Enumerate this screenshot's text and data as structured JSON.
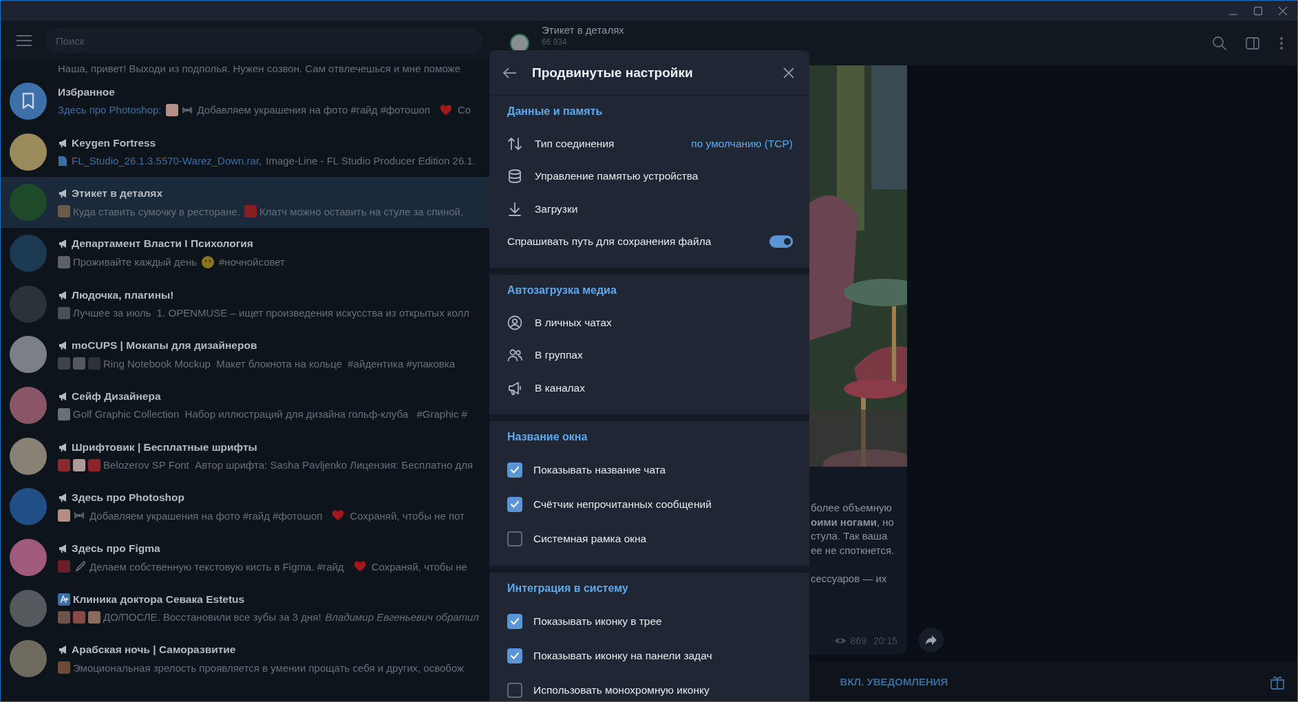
{
  "search": {
    "placeholder": "Поиск"
  },
  "chat_list_top": {
    "preview": "Наша, привет! Выходи из подполья. Нужен созвон. Сам отвлечешься и мне поможе"
  },
  "chats": [
    {
      "kind": "saved",
      "name": "Избранное",
      "color": "#3d6fa8",
      "selected": false,
      "preview": [
        {
          "kind": "link",
          "text": "Здесь про Photoshop:"
        },
        {
          "kind": "thumb",
          "color": "#b48f86"
        },
        {
          "kind": "bow"
        },
        {
          "kind": "text",
          "text": "Добавляем украшения на фото #гайд #фотошоп"
        },
        {
          "kind": "heart"
        },
        {
          "kind": "text",
          "text": "Со"
        }
      ]
    },
    {
      "kind": "channel",
      "name": "Keygen Fortress",
      "color": "#9a8a5c",
      "selected": false,
      "preview": [
        {
          "kind": "file"
        },
        {
          "kind": "link",
          "text": "FL_Studio_26.1.3.5570-Warez_Down.rar,"
        },
        {
          "kind": "text",
          "text": "Image-Line - FL Studio Producer Edition 26.1."
        }
      ]
    },
    {
      "kind": "channel",
      "name": "Этикет в деталях",
      "color": "#1f4a2a",
      "selected": true,
      "preview": [
        {
          "kind": "thumb",
          "color": "#6a5a48"
        },
        {
          "kind": "text",
          "text": "Куда ставить сумочку в ресторане."
        },
        {
          "kind": "thumb",
          "color": "#8a1e22"
        },
        {
          "kind": "text",
          "text": "Клатч можно оставить на стуле за спиной,"
        }
      ]
    },
    {
      "kind": "channel",
      "name": "Департамент Власти I Психология",
      "color": "#1c3a52",
      "selected": false,
      "preview": [
        {
          "kind": "thumb",
          "color": "#5e6268"
        },
        {
          "kind": "text",
          "text": "Проживайте каждый день"
        },
        {
          "kind": "emoji"
        },
        {
          "kind": "text",
          "text": "#ночнойсовет"
        }
      ]
    },
    {
      "kind": "channel",
      "name": "Людочка, плагины!",
      "color": "#2c323a",
      "selected": false,
      "preview": [
        {
          "kind": "thumb",
          "color": "#4a4f58"
        },
        {
          "kind": "text",
          "text": "Лучшее за июль  1. OPENMUSE – ищет произведения искусства из открытых колл"
        }
      ]
    },
    {
      "kind": "channel",
      "name": "moCUPS | Мокапы для дизайнеров",
      "color": "#7b7f86",
      "selected": false,
      "preview": [
        {
          "kind": "thumb",
          "color": "#3e4249"
        },
        {
          "kind": "thumb",
          "color": "#54585e"
        },
        {
          "kind": "thumb",
          "color": "#2e3237"
        },
        {
          "kind": "text",
          "text": "Ring Notebook Mockup  Макет блокнота на кольце  #айдентика #упаковка"
        }
      ]
    },
    {
      "kind": "channel",
      "name": "Сейф Дизайнера",
      "color": "#8a5566",
      "selected": false,
      "preview": [
        {
          "kind": "thumb",
          "color": "#6b6e72"
        },
        {
          "kind": "text",
          "text": "Golf Graphic Collection  Набор иллюстраций для дизайна гольф-клуба   #Graphic #"
        }
      ]
    },
    {
      "kind": "channel",
      "name": "Шрифтовик | Бесплатные шрифты",
      "color": "#8a8176",
      "selected": false,
      "preview": [
        {
          "kind": "thumb",
          "color": "#8a2a2e"
        },
        {
          "kind": "thumb",
          "color": "#b09a98"
        },
        {
          "kind": "thumb",
          "color": "#8f2428"
        },
        {
          "kind": "text",
          "text": "Belozerov SP Font  Автор шрифта: Sasha Pavljenko Лицензия: Бесплатно для"
        }
      ]
    },
    {
      "kind": "channel",
      "name": "Здесь про Photoshop",
      "color": "#1f4f86",
      "selected": false,
      "preview": [
        {
          "kind": "thumb",
          "color": "#b48f86"
        },
        {
          "kind": "bow"
        },
        {
          "kind": "text",
          "text": "Добавляем украшения на фото #гайд #фотошоп"
        },
        {
          "kind": "heart"
        },
        {
          "kind": "text",
          "text": "Сохраняй, чтобы не пот"
        }
      ]
    },
    {
      "kind": "channel",
      "name": "Здесь про Figma",
      "color": "#a05a7a",
      "selected": false,
      "preview": [
        {
          "kind": "thumb",
          "color": "#6a2026"
        },
        {
          "kind": "brush"
        },
        {
          "kind": "text",
          "text": "Делаем собственную текстовую кисть в Figma. #гайд"
        },
        {
          "kind": "heart"
        },
        {
          "kind": "text",
          "text": "Сохраняй, чтобы не"
        }
      ]
    },
    {
      "kind": "business",
      "name": "Клиника доктора Севака Estetus",
      "color": "#55585c",
      "selected": false,
      "preview": [
        {
          "kind": "thumb",
          "color": "#6e5448"
        },
        {
          "kind": "thumb",
          "color": "#8a4a44"
        },
        {
          "kind": "thumb",
          "color": "#8e6a5e"
        },
        {
          "kind": "text",
          "text": "ДО/ПОСЛЕ. Восстановили все зубы за 3 дня!"
        },
        {
          "kind": "italic",
          "text": "Владимир Евгеньевич обратил"
        }
      ]
    },
    {
      "kind": "channel",
      "name": "Арабская ночь | Саморазвитие",
      "color": "#6f6a5e",
      "selected": false,
      "preview": [
        {
          "kind": "thumb",
          "color": "#6e4a38"
        },
        {
          "kind": "text",
          "text": "Эмоциональная зрелость проявляется в умении прощать себя и других, освобож"
        }
      ]
    }
  ],
  "chat": {
    "title": "Этикет в деталях",
    "subtitle": "66 934",
    "message": {
      "paragraphs": [
        [
          "более объемную",
          "**оими ногами**, но",
          "стула. Так ваша",
          "ее не споткнется."
        ],
        [
          "сессуаров — их"
        ]
      ],
      "views": "869",
      "time": "20:15"
    },
    "bottom_button": "ВКЛ. УВЕДОМЛЕНИЯ"
  },
  "settings": {
    "title": "Продвинутые настройки",
    "sections": [
      {
        "title": "Данные и память",
        "rows": [
          {
            "kind": "connection",
            "label": "Тип соединения",
            "value": "по умолчанию (TCP)"
          },
          {
            "kind": "storage",
            "label": "Управление памятью устройства"
          },
          {
            "kind": "downloads",
            "label": "Загрузки"
          },
          {
            "kind": "toggle",
            "label": "Спрашивать путь для сохранения файла",
            "on": true
          }
        ]
      },
      {
        "title": "Автозагрузка медиа",
        "rows": [
          {
            "kind": "private",
            "label": "В личных чатах"
          },
          {
            "kind": "groups",
            "label": "В группах"
          },
          {
            "kind": "channels",
            "label": "В каналах"
          }
        ]
      },
      {
        "title": "Название окна",
        "rows": [
          {
            "kind": "checkbox",
            "label": "Показывать название чата",
            "checked": true
          },
          {
            "kind": "checkbox",
            "label": "Счётчик непрочитанных сообщений",
            "checked": true
          },
          {
            "kind": "checkbox",
            "label": "Системная рамка окна",
            "checked": false
          }
        ]
      },
      {
        "title": "Интеграция в систему",
        "rows": [
          {
            "kind": "checkbox",
            "label": "Показывать иконку в трее",
            "checked": true
          },
          {
            "kind": "checkbox",
            "label": "Показывать иконку на панели задач",
            "checked": true
          },
          {
            "kind": "checkbox",
            "label": "Использовать монохромную иконку",
            "checked": false
          }
        ]
      }
    ]
  }
}
